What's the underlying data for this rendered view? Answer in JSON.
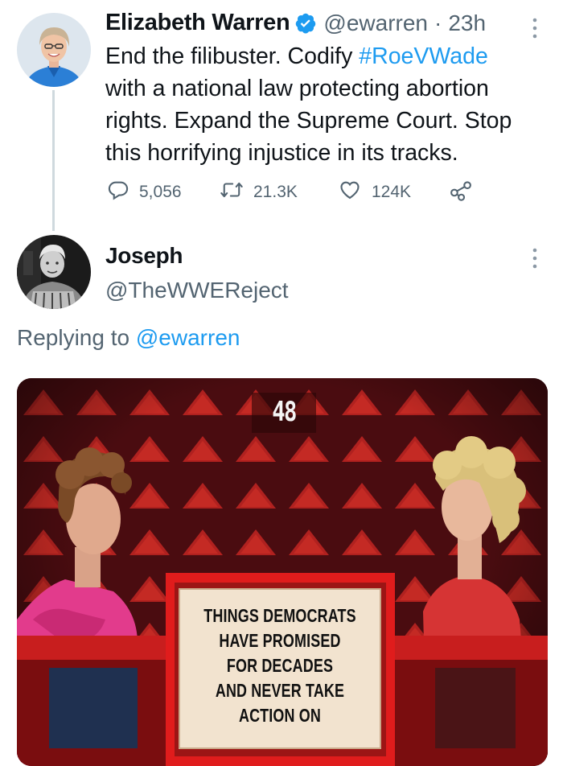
{
  "tweet": {
    "author_name": "Elizabeth Warren",
    "author_handle": "@ewarren",
    "separator": "·",
    "time": "23h",
    "text_before": "End the filibuster. Codify ",
    "hashtag": "#RoeVWade",
    "text_after": "with a national law protecting abortion rights. Expand the Supreme Court. Stop this horrifying injustice in its tracks.",
    "line1": "End the filibuster. Codify",
    "line2": "with a national law protecting abortion",
    "line3": "rights. Expand the Supreme Court. Stop",
    "line4": "this horrifying injustice in its tracks.",
    "replies": "5,056",
    "retweets": "21.3K",
    "likes": "124K",
    "verified": true
  },
  "reply": {
    "author_name": "Joseph",
    "author_handle": "@TheWWEReject",
    "replying_prefix": "Replying to",
    "replying_to": "@ewarren",
    "image": {
      "counter": "48",
      "sign_lines": [
        "THINGS DEMOCRATS",
        "HAVE PROMISED",
        "FOR DECADES",
        "AND NEVER TAKE",
        "ACTION ON"
      ]
    }
  },
  "colors": {
    "accent": "#1d9bf0",
    "secondary_text": "#536471",
    "thread_line": "#cfd9de"
  }
}
